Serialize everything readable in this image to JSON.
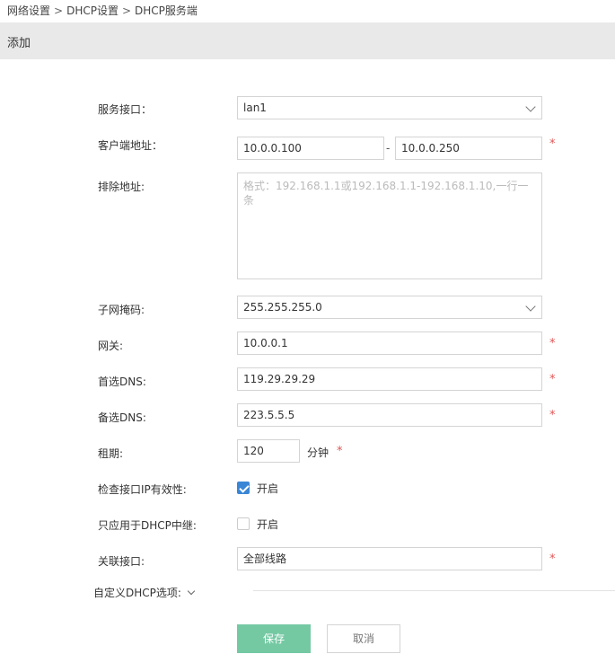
{
  "breadcrumb": {
    "items": [
      "网络设置",
      "DHCP设置",
      "DHCP服务端"
    ],
    "separator": ">"
  },
  "header": {
    "title": "添加"
  },
  "form": {
    "service_interface": {
      "label": "服务接口：",
      "value": "lan1"
    },
    "client_address": {
      "label": "客户端地址：",
      "start": "10.0.0.100",
      "separator": "-",
      "end": "10.0.0.250"
    },
    "exclude_address": {
      "label": "排除地址:",
      "placeholder": "格式：192.168.1.1或192.168.1.1-192.168.1.10,一行一条"
    },
    "subnet_mask": {
      "label": "子网掩码:",
      "value": "255.255.255.0"
    },
    "gateway": {
      "label": "网关:",
      "value": "10.0.0.1"
    },
    "primary_dns": {
      "label": "首选DNS:",
      "value": "119.29.29.29"
    },
    "secondary_dns": {
      "label": "备选DNS:",
      "value": "223.5.5.5"
    },
    "lease": {
      "label": "租期:",
      "value": "120",
      "unit": "分钟"
    },
    "check_interface_ip": {
      "label": "检查接口IP有效性:",
      "option": "开启",
      "checked": true
    },
    "dhcp_relay_only": {
      "label": "只应用于DHCP中继:",
      "option": "开启",
      "checked": false
    },
    "associated_interface": {
      "label": "关联接口:",
      "value": "全部线路"
    },
    "required_mark": "*"
  },
  "custom_options": {
    "label": "自定义DHCP选项:"
  },
  "actions": {
    "save": "保存",
    "cancel": "取消"
  },
  "colors": {
    "accent": "#3a86d6",
    "save_button": "#74c9a3",
    "required": "#e25555",
    "header_bg": "#e9e9e9"
  }
}
